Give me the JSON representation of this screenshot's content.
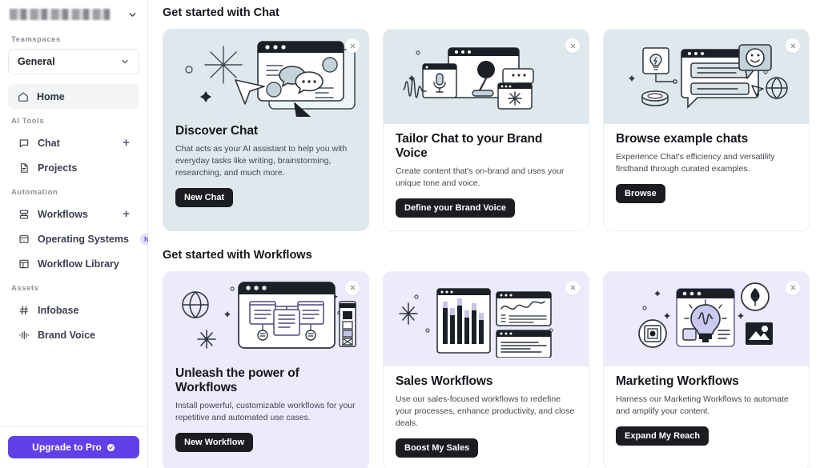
{
  "sidebar": {
    "account": {
      "name_redacted": "",
      "chevron_icon": "chevron-down-icon"
    },
    "teamspaces_label": "Teamspaces",
    "teamspace_select": {
      "value": "General",
      "chevron_icon": "chevron-down-icon"
    },
    "home": {
      "label": "Home",
      "icon": "home-icon"
    },
    "groups": [
      {
        "label": "AI Tools",
        "items": [
          {
            "label": "Chat",
            "icon": "chat-bubble-icon",
            "has_plus": true,
            "badge": null
          },
          {
            "label": "Projects",
            "icon": "document-icon",
            "has_plus": false,
            "badge": null
          }
        ]
      },
      {
        "label": "Automation",
        "items": [
          {
            "label": "Workflows",
            "icon": "workflows-icon",
            "has_plus": true,
            "badge": null
          },
          {
            "label": "Operating Systems",
            "icon": "operating-systems-icon",
            "has_plus": false,
            "badge": "NEW"
          },
          {
            "label": "Workflow Library",
            "icon": "library-icon",
            "has_plus": false,
            "badge": null
          }
        ]
      },
      {
        "label": "Assets",
        "items": [
          {
            "label": "Infobase",
            "icon": "hash-icon",
            "has_plus": false,
            "badge": null
          },
          {
            "label": "Brand Voice",
            "icon": "waveform-icon",
            "has_plus": false,
            "badge": null
          }
        ]
      }
    ],
    "upgrade": {
      "label": "Upgrade to Pro",
      "icon": "check-circle-icon"
    }
  },
  "main": {
    "section_chat_title": "Get started with Chat",
    "section_workflows_title": "Get started with Workflows",
    "chat_cards": [
      {
        "title": "Discover Chat",
        "description": "Chat acts as your AI assistant to help you with everyday tasks like writing, brainstorming, researching, and much more.",
        "cta": "New Chat",
        "close_icon": "close-icon"
      },
      {
        "title": "Tailor Chat to your Brand Voice",
        "description": "Create content that's on-brand and uses your unique tone and voice.",
        "cta": "Define your Brand Voice",
        "close_icon": "close-icon"
      },
      {
        "title": "Browse example chats",
        "description": "Experience Chat's efficiency and versatility firsthand through curated examples.",
        "cta": "Browse",
        "close_icon": "close-icon"
      }
    ],
    "workflow_cards": [
      {
        "title": "Unleash the power of Workflows",
        "description": "Install powerful, customizable workflows for your repetitive and automated use cases.",
        "cta": "New Workflow",
        "close_icon": "close-icon"
      },
      {
        "title": "Sales Workflows",
        "description": "Use our sales-focused workflows to redefine your processes, enhance productivity, and close deals.",
        "cta": "Boost My Sales",
        "close_icon": "close-icon"
      },
      {
        "title": "Marketing Workflows",
        "description": "Harness our Marketing Workflows to automate and amplify your content.",
        "cta": "Expand My Reach",
        "close_icon": "close-icon"
      }
    ]
  },
  "colors": {
    "accent_purple": "#6240e8",
    "card_blue": "#dfe8ec",
    "card_purple": "#eceafb",
    "cta_dark": "#1b1d21",
    "badge_new_bg": "#e4dffb",
    "badge_new_text": "#6b4ee6"
  }
}
